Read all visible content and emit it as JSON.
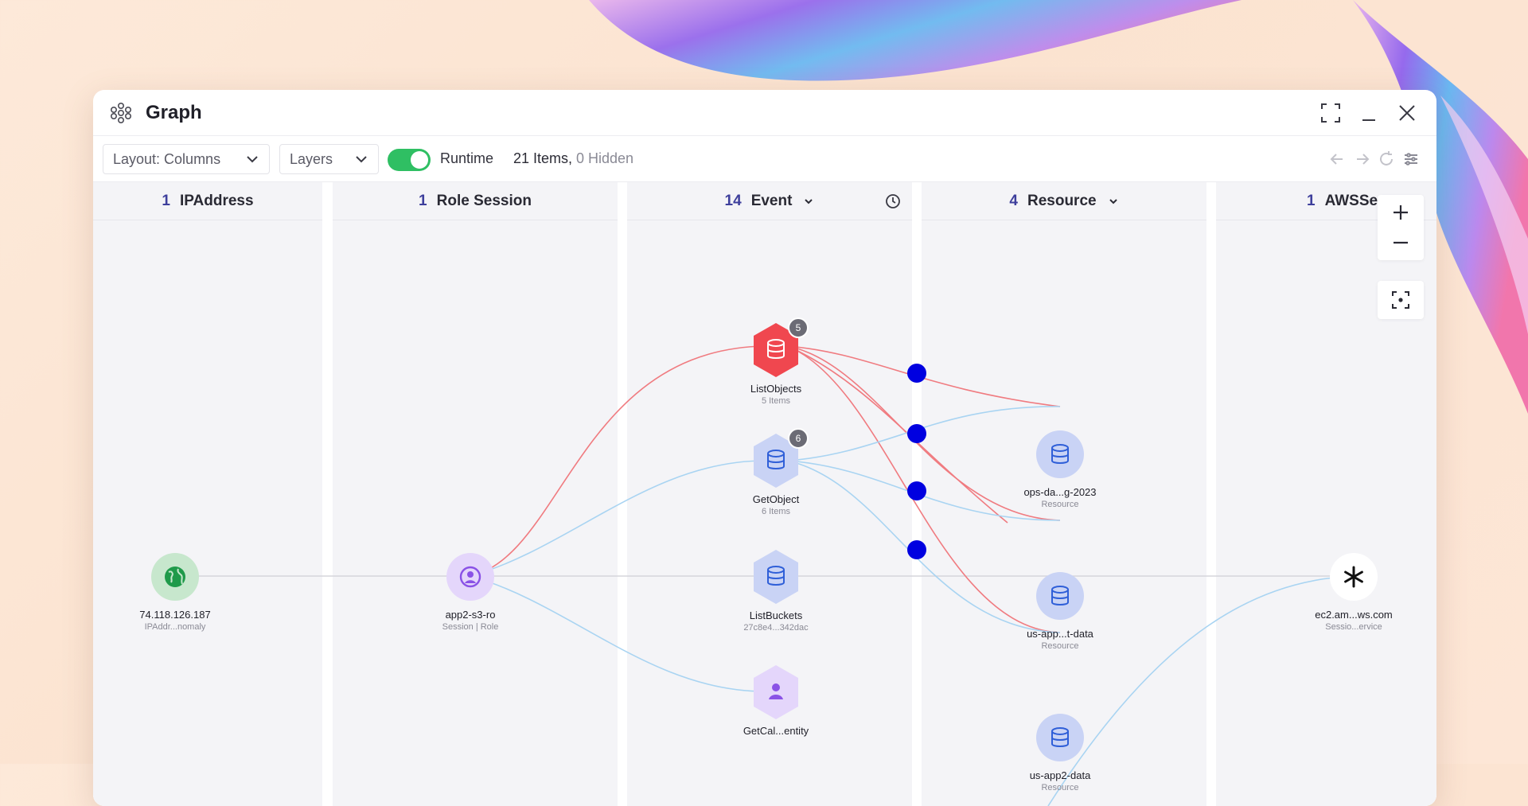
{
  "window": {
    "title": "Graph",
    "icon": "graph-cluster-icon",
    "controls": [
      "fullscreen-icon",
      "minimize-icon",
      "close-icon"
    ]
  },
  "toolbar": {
    "layout_label": "Layout: Columns",
    "layers_label": "Layers",
    "runtime_label": "Runtime",
    "runtime_on": true,
    "items_text": "21 Items,",
    "hidden_text": "0 Hidden",
    "nav_icons": [
      "back-arrow-icon",
      "forward-arrow-icon",
      "refresh-icon",
      "filter-sliders-icon"
    ]
  },
  "columns": [
    {
      "count": "1",
      "label": "IPAddress"
    },
    {
      "count": "1",
      "label": "Role Session"
    },
    {
      "count": "14",
      "label": "Event"
    },
    {
      "count": "4",
      "label": "Resource"
    },
    {
      "count": "1",
      "label": "AWSSe"
    }
  ],
  "nodes": {
    "ip": {
      "label": "74.118.126.187",
      "sub": "IPAddr...nomaly"
    },
    "session": {
      "label": "app2-s3-ro",
      "sub": "Session | Role"
    },
    "list_objects": {
      "label": "ListObjects",
      "sub": "5 Items",
      "badge": "5"
    },
    "get_object": {
      "label": "GetObject",
      "sub": "6 Items",
      "badge": "6"
    },
    "list_buckets": {
      "label": "ListBuckets",
      "sub": "27c8e4...342dac"
    },
    "get_caller": {
      "label": "GetCal...entity",
      "sub": ""
    },
    "ops_data": {
      "label": "ops-da...g-2023",
      "sub": "Resource"
    },
    "us_app_t": {
      "label": "us-app...t-data",
      "sub": "Resource"
    },
    "us_app2": {
      "label": "us-app2-data",
      "sub": "Resource"
    },
    "ec2": {
      "label": "ec2.am...ws.com",
      "sub": "Sessio...ervice"
    }
  },
  "colors": {
    "alert": "#f0474f",
    "event_blue": "#c9d3f5",
    "edge_red": "#f07b80",
    "edge_blue": "#a9d4f2",
    "junction": "#0000e0",
    "toggle_on": "#2fbf63",
    "count_accent": "#3e3f9c"
  }
}
